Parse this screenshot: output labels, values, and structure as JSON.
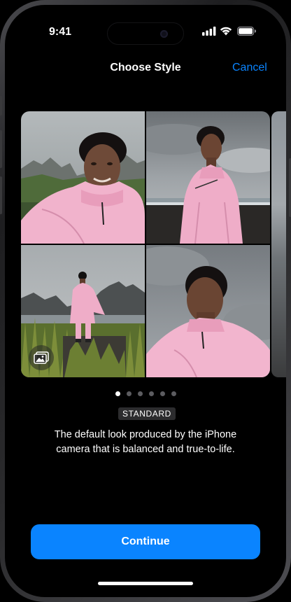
{
  "status_bar": {
    "time": "9:41",
    "icons": [
      "cellular-signal-icon",
      "wifi-icon",
      "battery-icon"
    ]
  },
  "nav": {
    "title": "Choose Style",
    "cancel_label": "Cancel"
  },
  "gallery": {
    "photos": [
      "portrait-selfie-mountains",
      "portrait-beach-clouds",
      "portrait-standing-grass",
      "portrait-profile-sky"
    ],
    "page_count": 6,
    "active_page": 1
  },
  "style": {
    "name": "STANDARD",
    "description_line1": "The default look produced by the iPhone",
    "description_line2": "camera that is balanced and true-to-life."
  },
  "actions": {
    "continue_label": "Continue"
  },
  "colors": {
    "accent": "#0a84ff",
    "background": "#000000",
    "tag_background": "#2c2c2e"
  }
}
